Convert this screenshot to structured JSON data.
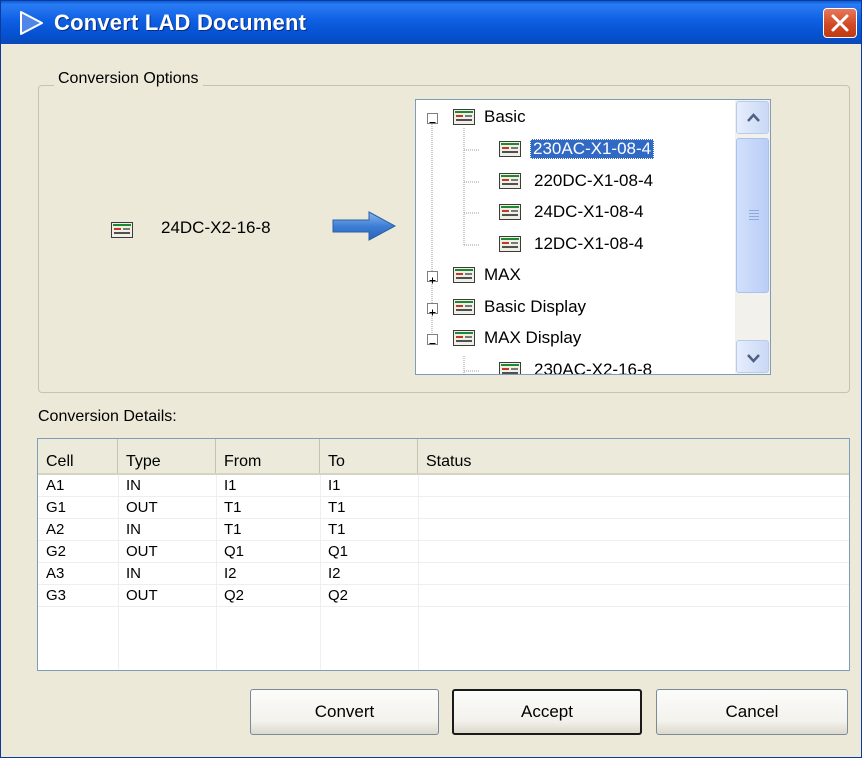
{
  "window": {
    "title": "Convert LAD Document"
  },
  "options": {
    "group_label": "Conversion Options",
    "source": {
      "label": "24DC-X2-16-8",
      "icon": "module-icon"
    },
    "tree": {
      "items": [
        {
          "label": "Basic",
          "expander": "⊟",
          "children": [
            {
              "label": "230AC-X1-08-4",
              "selected": true
            },
            {
              "label": "220DC-X1-08-4"
            },
            {
              "label": "24DC-X1-08-4"
            },
            {
              "label": "12DC-X1-08-4"
            }
          ]
        },
        {
          "label": "MAX",
          "expander": "⊞"
        },
        {
          "label": "Basic Display",
          "expander": "⊞"
        },
        {
          "label": "MAX Display",
          "expander": "⊟",
          "children": [
            {
              "label": "230AC-X2-16-8"
            }
          ]
        }
      ]
    }
  },
  "details": {
    "label": "Conversion Details:",
    "columns": [
      "Cell",
      "Type",
      "From",
      "To",
      "Status"
    ],
    "rows": [
      {
        "cell": "A1",
        "type": "IN",
        "from": "I1",
        "to": "I1",
        "status": ""
      },
      {
        "cell": "G1",
        "type": "OUT",
        "from": "T1",
        "to": "T1",
        "status": ""
      },
      {
        "cell": "A2",
        "type": "IN",
        "from": "T1",
        "to": "T1",
        "status": ""
      },
      {
        "cell": "G2",
        "type": "OUT",
        "from": "Q1",
        "to": "Q1",
        "status": ""
      },
      {
        "cell": "A3",
        "type": "IN",
        "from": "I2",
        "to": "I2",
        "status": ""
      },
      {
        "cell": "G3",
        "type": "OUT",
        "from": "Q2",
        "to": "Q2",
        "status": ""
      }
    ]
  },
  "buttons": {
    "convert": "Convert",
    "accept": "Accept",
    "cancel": "Cancel"
  },
  "colors": {
    "titlebar": "#0451d0",
    "selection": "#316ac5",
    "face": "#ece9d8",
    "close": "#d14a25"
  }
}
